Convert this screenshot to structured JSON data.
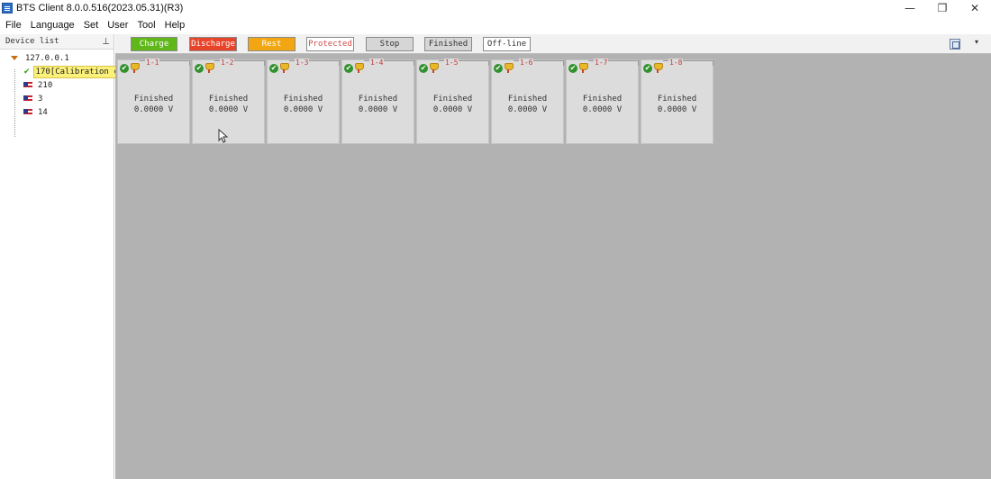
{
  "window": {
    "title": "BTS Client 8.0.0.516(2023.05.31)(R3)",
    "minimize": "—",
    "restore": "❐",
    "close": "✕"
  },
  "menu": [
    "File",
    "Language",
    "Set",
    "User",
    "Tool",
    "Help"
  ],
  "device_panel": {
    "title": "Device list",
    "pin": "ꟷ",
    "root": "127.0.0.1",
    "devices": [
      {
        "label": "170[Calibration c",
        "selected": true
      },
      {
        "label": "210",
        "selected": false
      },
      {
        "label": "3",
        "selected": false
      },
      {
        "label": "14",
        "selected": false
      }
    ]
  },
  "legend": {
    "charge": "Charge",
    "discharge": "Discharge",
    "rest": "Rest",
    "protected": "Protected",
    "stop": "Stop",
    "finished": "Finished",
    "offline": "Off-line",
    "dropdown": "▾"
  },
  "colors": {
    "charge": "#5fb818",
    "discharge": "#e8442a",
    "rest": "#f2a712",
    "protected_text": "#d24b4b",
    "content_bg": "#b2b2b2"
  },
  "channels": [
    {
      "id": "1-1",
      "status": "Finished",
      "voltage": "0.0000 V"
    },
    {
      "id": "1-2",
      "status": "Finished",
      "voltage": "0.0000 V"
    },
    {
      "id": "1-3",
      "status": "Finished",
      "voltage": "0.0000 V"
    },
    {
      "id": "1-4",
      "status": "Finished",
      "voltage": "0.0000 V"
    },
    {
      "id": "1-5",
      "status": "Finished",
      "voltage": "0.0000 V"
    },
    {
      "id": "1-6",
      "status": "Finished",
      "voltage": "0.0000 V"
    },
    {
      "id": "1-7",
      "status": "Finished",
      "voltage": "0.0000 V"
    },
    {
      "id": "1-8",
      "status": "Finished",
      "voltage": "0.0000 V"
    }
  ]
}
